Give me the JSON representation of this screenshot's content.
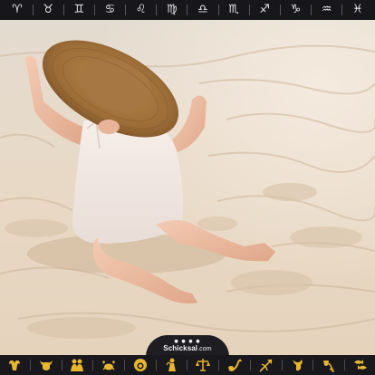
{
  "top_bar": {
    "zodiac_symbols": [
      "♈",
      "♉",
      "♊",
      "♋",
      "♌",
      "♍",
      "♎",
      "♏",
      "♐",
      "♑",
      "♒",
      "♓"
    ]
  },
  "photo": {
    "description_icon": "photo-image"
  },
  "brand": {
    "name": "Schicksal",
    "tld": ".com",
    "dots": "● ● ● ●"
  },
  "bottom_bar": {
    "symbols": [
      {
        "icon": "ram-icon"
      },
      {
        "icon": "bull-icon"
      },
      {
        "icon": "twins-icon"
      },
      {
        "icon": "crab-icon"
      },
      {
        "icon": "lion-icon"
      },
      {
        "icon": "maiden-icon"
      },
      {
        "icon": "scales-icon"
      },
      {
        "icon": "scorpion-icon"
      },
      {
        "icon": "archer-icon"
      },
      {
        "icon": "goat-icon"
      },
      {
        "icon": "water-bearer-icon"
      },
      {
        "icon": "fish-icon"
      }
    ]
  },
  "colors": {
    "bar_bg": "#16161b",
    "gold": "#e7b52e",
    "sand": "#e9d9c5"
  }
}
